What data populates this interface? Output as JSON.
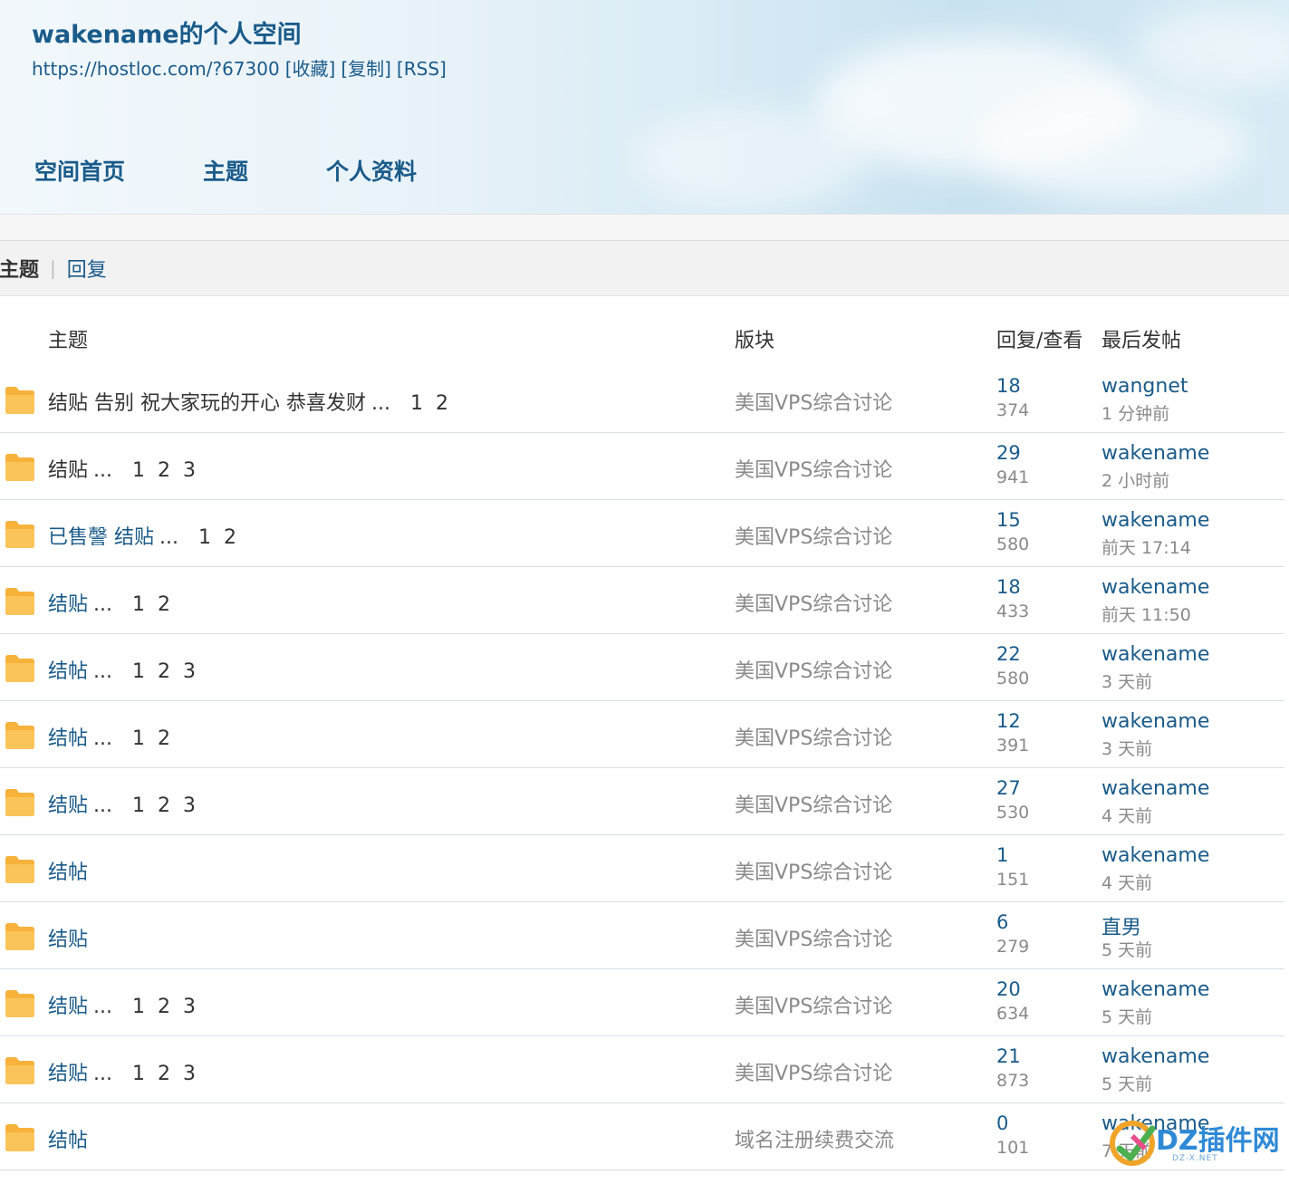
{
  "header": {
    "title": "wakename的个人空间",
    "url": "https://hostloc.com/?67300",
    "links": [
      "[收藏]",
      "[复制]",
      "[RSS]"
    ],
    "nav": [
      "空间首页",
      "主题",
      "个人资料"
    ]
  },
  "tabs": {
    "active": "主题",
    "separator": "|",
    "other": "回复"
  },
  "table": {
    "headers": {
      "subject": "主题",
      "forum": "版块",
      "stats": "回复/查看",
      "last": "最后发帖"
    },
    "rows": [
      {
        "title": "结贴 告别 祝大家玩的开心 恭喜发财",
        "ellipsis": "...",
        "pages": [
          "1",
          "2"
        ],
        "forum": "美国VPS综合讨论",
        "replies": "18",
        "views": "374",
        "last_user": "wangnet",
        "last_time": "1 分钟前",
        "title_link": false
      },
      {
        "title": "结贴",
        "ellipsis": "...",
        "pages": [
          "1",
          "2",
          "3"
        ],
        "forum": "美国VPS综合讨论",
        "replies": "29",
        "views": "941",
        "last_user": "wakename",
        "last_time": "2 小时前",
        "title_link": false
      },
      {
        "title": "已售謦 结贴",
        "ellipsis": "...",
        "pages": [
          "1",
          "2"
        ],
        "forum": "美国VPS综合讨论",
        "replies": "15",
        "views": "580",
        "last_user": "wakename",
        "last_time": "前天 17:14",
        "title_link": true
      },
      {
        "title": "结贴",
        "ellipsis": "...",
        "pages": [
          "1",
          "2"
        ],
        "forum": "美国VPS综合讨论",
        "replies": "18",
        "views": "433",
        "last_user": "wakename",
        "last_time": "前天 11:50",
        "title_link": true
      },
      {
        "title": "结帖",
        "ellipsis": "...",
        "pages": [
          "1",
          "2",
          "3"
        ],
        "forum": "美国VPS综合讨论",
        "replies": "22",
        "views": "580",
        "last_user": "wakename",
        "last_time": "3 天前",
        "title_link": true
      },
      {
        "title": "结帖",
        "ellipsis": "...",
        "pages": [
          "1",
          "2"
        ],
        "forum": "美国VPS综合讨论",
        "replies": "12",
        "views": "391",
        "last_user": "wakename",
        "last_time": "3 天前",
        "title_link": true
      },
      {
        "title": "结贴",
        "ellipsis": "...",
        "pages": [
          "1",
          "2",
          "3"
        ],
        "forum": "美国VPS综合讨论",
        "replies": "27",
        "views": "530",
        "last_user": "wakename",
        "last_time": "4 天前",
        "title_link": true
      },
      {
        "title": "结帖",
        "ellipsis": "",
        "pages": [],
        "forum": "美国VPS综合讨论",
        "replies": "1",
        "views": "151",
        "last_user": "wakename",
        "last_time": "4 天前",
        "title_link": true
      },
      {
        "title": "结贴",
        "ellipsis": "",
        "pages": [],
        "forum": "美国VPS综合讨论",
        "replies": "6",
        "views": "279",
        "last_user": "直男",
        "last_time": "5 天前",
        "title_link": true
      },
      {
        "title": "结贴",
        "ellipsis": "...",
        "pages": [
          "1",
          "2",
          "3"
        ],
        "forum": "美国VPS综合讨论",
        "replies": "20",
        "views": "634",
        "last_user": "wakename",
        "last_time": "5 天前",
        "title_link": true
      },
      {
        "title": "结贴",
        "ellipsis": "...",
        "pages": [
          "1",
          "2",
          "3"
        ],
        "forum": "美国VPS综合讨论",
        "replies": "21",
        "views": "873",
        "last_user": "wakename",
        "last_time": "5 天前",
        "title_link": true
      },
      {
        "title": "结帖",
        "ellipsis": "",
        "pages": [],
        "forum": "域名注册续费交流",
        "replies": "0",
        "views": "101",
        "last_user": "wakename",
        "last_time": "7 天前",
        "title_link": true
      }
    ]
  },
  "watermark": {
    "text": "DZ插件网",
    "sub": "DZ-X.NET"
  },
  "colors": {
    "link": "#1a5b8a",
    "muted": "#8a8a8a",
    "folder": "#f7b23b"
  }
}
